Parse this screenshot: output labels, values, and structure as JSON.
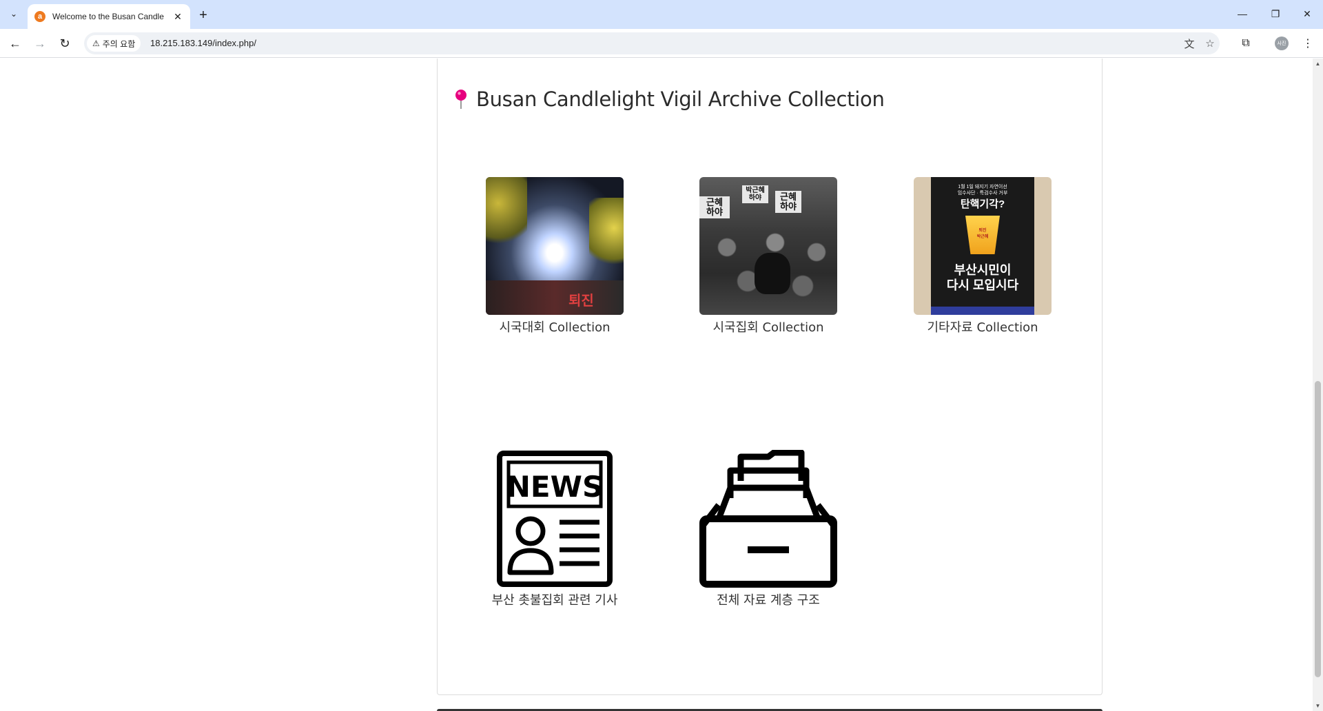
{
  "browser": {
    "tab_title": "Welcome to the Busan Candle",
    "favicon_letter": "a",
    "security_label": "주의 요함",
    "url": "18.215.183.149/index.php/",
    "avatar_text": "사진"
  },
  "page": {
    "heading": "Busan Candlelight Vigil Archive Collection",
    "collections": [
      {
        "label": "시국대회 Collection",
        "image": "candlelight-crowd-photo"
      },
      {
        "label": "시국집회 Collection",
        "image": "bw-protest-photo"
      },
      {
        "label": "기타자료 Collection",
        "image": "poster-photo"
      },
      {
        "label": "부산 촛불집회 관련 기사",
        "image": "news-icon"
      },
      {
        "label": "전체 자료 계층 구조",
        "image": "archive-drawer-icon"
      }
    ],
    "photo_text": {
      "crowd_banner": "퇴진",
      "bw_sign_1": "근혜\n하야",
      "bw_sign_2": "박근혜\n하야",
      "bw_sign_3": "근혜\n하야",
      "poster_top": "1월 1일 돼지기 자연이선\n임수사단 · 특검수사 거부",
      "poster_question": "탄핵기각?",
      "poster_cup": "퇴진\n박근혜",
      "poster_main": "부산시민이\n다시 모입시다",
      "news_word": "NEWS"
    }
  },
  "colors": {
    "tabbar": "#d3e3fd",
    "pin": "#e6007e",
    "heading": "#2b2b2b"
  }
}
